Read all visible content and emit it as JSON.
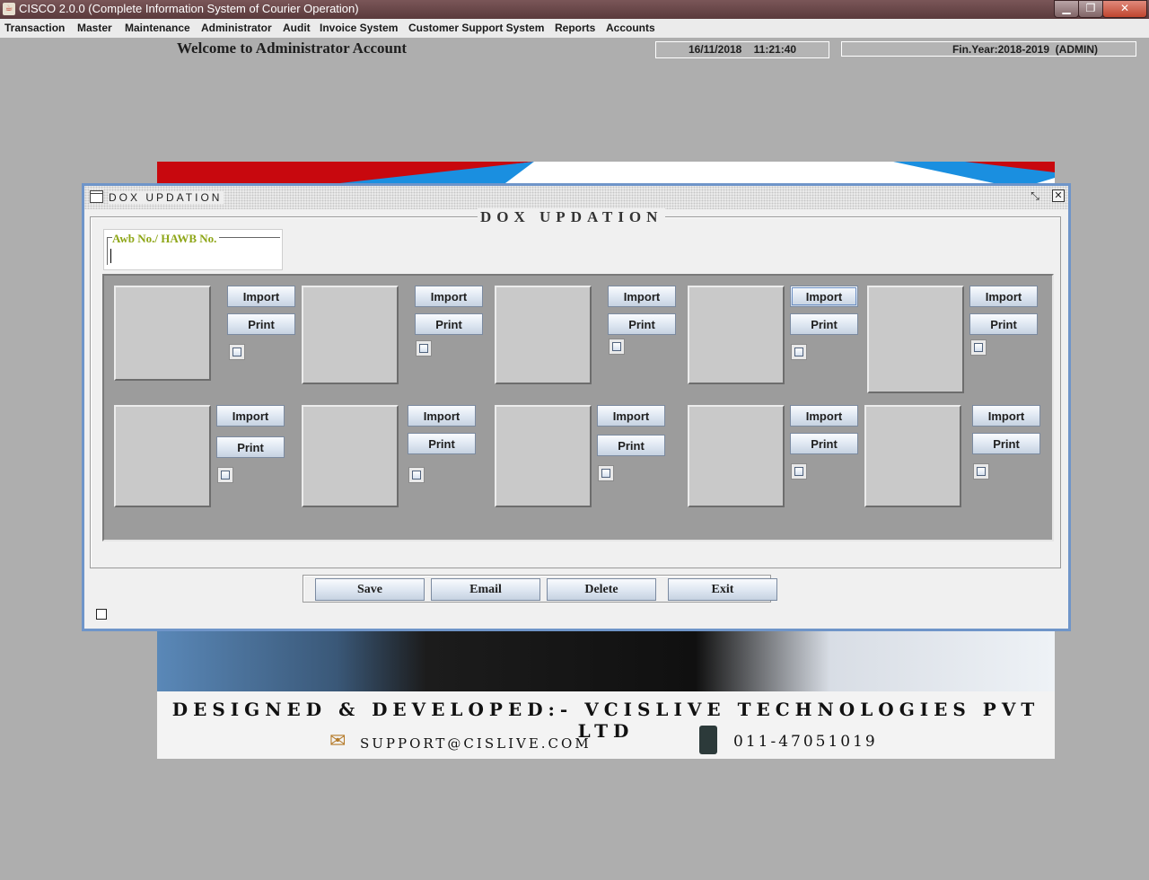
{
  "app": {
    "title": "CISCO 2.0.0 (Complete Information System of Courier Operation)"
  },
  "menu": [
    "Transaction",
    "Master",
    "Maintenance",
    "Administrator",
    "Audit",
    "Invoice System",
    "Customer Support System",
    "Reports",
    "Accounts"
  ],
  "status": {
    "welcome": "Welcome to Administrator Account",
    "datetime": "16/11/2018    11:21:40",
    "finyear": "Fin.Year:2018-2019  (ADMIN)"
  },
  "frame": {
    "title": "DOX  UPDATION",
    "group_title": "DOX  UPDATION",
    "awb_label": "Awb No./ HAWB No.",
    "awb_value": ""
  },
  "slots": [
    {
      "import_label": "Import",
      "print_label": "Print",
      "checked": false
    },
    {
      "import_label": "Import",
      "print_label": "Print",
      "checked": false
    },
    {
      "import_label": "Import",
      "print_label": "Print",
      "checked": false
    },
    {
      "import_label": "Import",
      "print_label": "Print",
      "checked": false
    },
    {
      "import_label": "Import",
      "print_label": "Print",
      "checked": false
    },
    {
      "import_label": "Import",
      "print_label": "Print",
      "checked": false
    },
    {
      "import_label": "Import",
      "print_label": "Print",
      "checked": false
    },
    {
      "import_label": "Import",
      "print_label": "Print",
      "checked": false
    },
    {
      "import_label": "Import",
      "print_label": "Print",
      "checked": false
    },
    {
      "import_label": "Import",
      "print_label": "Print",
      "checked": false
    }
  ],
  "actions": {
    "save": "Save",
    "email": "Email",
    "delete": "Delete",
    "exit": "Exit"
  },
  "footer": {
    "company": "DESIGNED & DEVELOPED:- VCISLIVE TECHNOLOGIES PVT LTD",
    "email": "SUPPORT@CISLIVE.COM",
    "phone": "011-47051019"
  },
  "colors": {
    "frame_border": "#6f95c9",
    "label_green": "#8ea617",
    "desktop": "#aeaeae"
  }
}
